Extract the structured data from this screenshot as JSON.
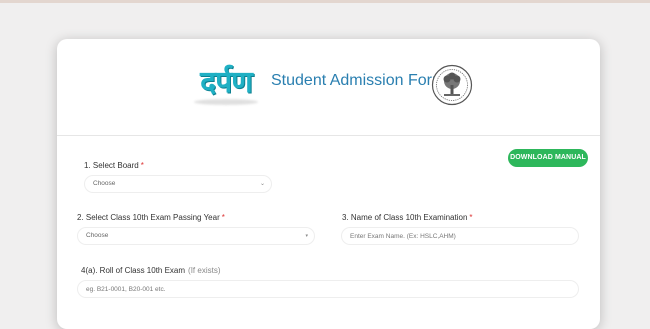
{
  "header": {
    "logo_text": "दर्पण",
    "title": "Student Admission Form"
  },
  "actions": {
    "download_manual": "DOWNLOAD MANUAL"
  },
  "form": {
    "board": {
      "label": "1. Select Board",
      "required": "*",
      "selected": "Choose"
    },
    "passing_year": {
      "label": "2. Select Class 10th Exam Passing Year",
      "required": "*",
      "selected": "Choose"
    },
    "exam_name": {
      "label": "3. Name of Class 10th Examination",
      "required": "*",
      "placeholder": "Enter Exam Name. (Ex: HSLC,AHM)"
    },
    "roll": {
      "label": "4(a). Roll of Class 10th Exam",
      "hint": "(If exists)",
      "placeholder": "eg. B21-0001, B20-001 etc."
    }
  },
  "colors": {
    "accent": "#2a7fb0",
    "button": "#2db75b",
    "required": "#dd3333"
  },
  "icons": {
    "caret": "chevron-down-icon",
    "emblem": "university-emblem-icon"
  }
}
